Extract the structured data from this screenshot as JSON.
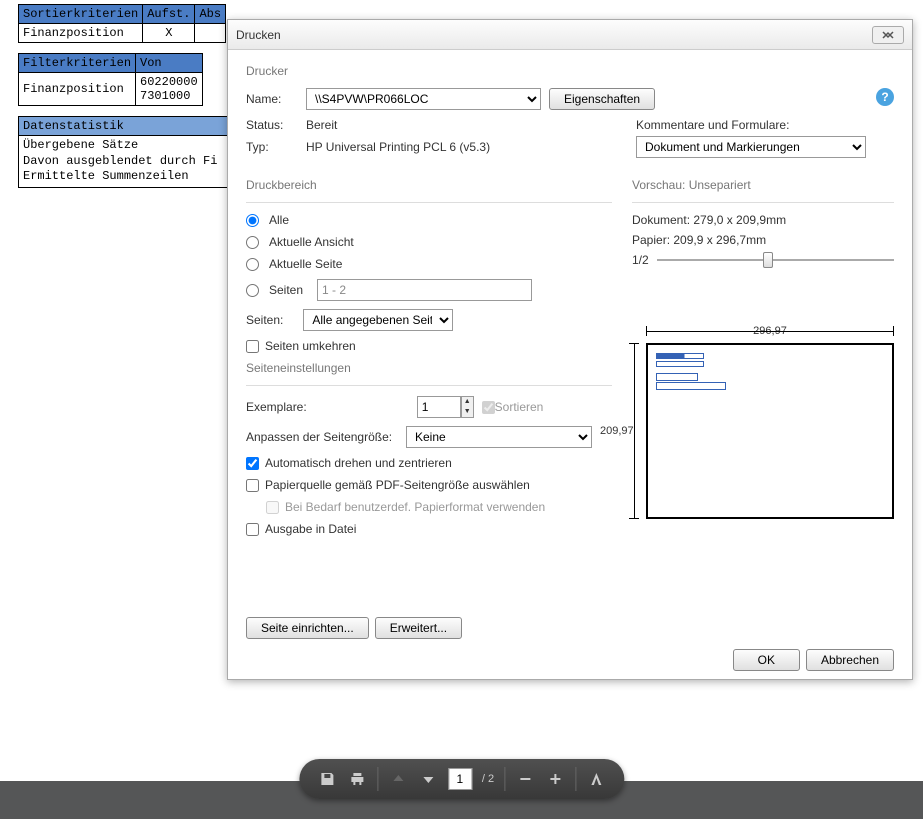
{
  "bg": {
    "t1": {
      "headers": [
        "Sortierkriterien",
        "Aufst.",
        "Abs"
      ],
      "row": [
        "Finanzposition",
        "X",
        ""
      ]
    },
    "t2": {
      "headers": [
        "Filterkriterien",
        "Von"
      ],
      "row": [
        "Finanzposition",
        "60220000\n7301000"
      ]
    },
    "stats": {
      "title": "Datenstatistik",
      "lines": "Übergebene Sätze\nDavon ausgeblendet durch Fi\nErmittelte Summenzeilen"
    }
  },
  "dialog": {
    "title": "Drucken",
    "printer": {
      "group": "Drucker",
      "name_label": "Name:",
      "name_value": "\\\\S4PVW\\PR066LOC",
      "props_btn": "Eigenschaften",
      "status_label": "Status:",
      "status_value": "Bereit",
      "type_label": "Typ:",
      "type_value": "HP Universal Printing PCL 6 (v5.3)",
      "comments_label": "Kommentare und Formulare:",
      "comments_value": "Dokument und Markierungen"
    },
    "range": {
      "group": "Druckbereich",
      "all": "Alle",
      "view": "Aktuelle Ansicht",
      "page": "Aktuelle Seite",
      "pages": "Seiten",
      "pages_value": "1 - 2",
      "subset_label": "Seiten:",
      "subset_value": "Alle angegebenen Seiten",
      "reverse": "Seiten umkehren"
    },
    "pagesetup": {
      "group": "Seiteneinstellungen",
      "copies_label": "Exemplare:",
      "copies_value": "1",
      "collate": "Sortieren",
      "scaling_label": "Anpassen der Seitengröße:",
      "scaling_value": "Keine",
      "rotate": "Automatisch drehen und zentrieren",
      "papersource": "Papierquelle gemäß PDF-Seitengröße auswählen",
      "custom": "Bei Bedarf benutzerdef. Papierformat verwenden"
    },
    "output_file": "Ausgabe in Datei",
    "preview": {
      "group": "Vorschau: Unsepariert",
      "doc": "Dokument: 279,0 x 209,9mm",
      "paper": "Papier: 209,9 x 296,7mm",
      "zoom": "1/2",
      "dim_w": "296,97",
      "dim_h": "209,97"
    },
    "setup_btn": "Seite einrichten...",
    "adv_btn": "Erweitert...",
    "ok": "OK",
    "cancel": "Abbrechen"
  },
  "toolbar": {
    "page_current": "1",
    "page_total": "/ 2"
  }
}
